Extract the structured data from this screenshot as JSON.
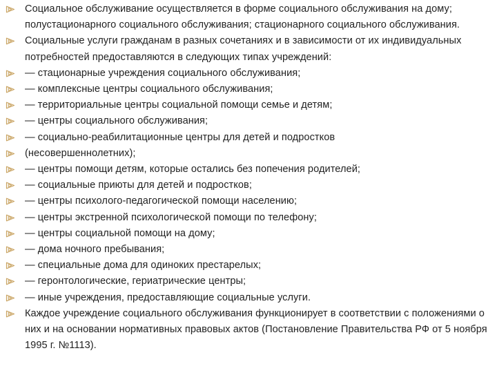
{
  "slide": {
    "bullet_icon": "hollow-triangle-bullet-icon",
    "accent_color": "#c9a463",
    "items": [
      "Социальное обслуживание осуществляется в форме социального обслуживания на дому; полустационарного социального обслуживания; стационарного социального обслуживания.",
      "Социальные услуги гражданам в разных сочетаниях и в зависимости от их индивидуальных потребностей предоставляются в следующих типах учреждений:",
      "— стационарные учреждения социального обслуживания;",
      "— комплексные центры социального обслуживания;",
      "— территориальные центры социальной помощи семье и детям;",
      "— центры социального обслуживания;",
      "— социально-реабилитационные центры для детей и подростков",
      "(несовершеннолетних);",
      "— центры помощи детям, которые остались без попечения родителей;",
      "— социальные приюты для детей и подростков;",
      "— центры психолого-педагогической помощи населению;",
      "— центры экстренной психологической помощи по телефону;",
      "— центры социальной помощи на дому;",
      "— дома ночного пребывания;",
      "— специальные дома для одиноких престарелых;",
      "— геронтологические, гериатрические центры;",
      "— иные учреждения, предоставляющие социальные услуги.",
      "Каждое учреждение социального обслуживания функционирует в соответствии с положениями о них и на основании нормативных правовых актов (Постановление Правительства РФ от 5 ноября 1995 г. №1113)."
    ]
  }
}
